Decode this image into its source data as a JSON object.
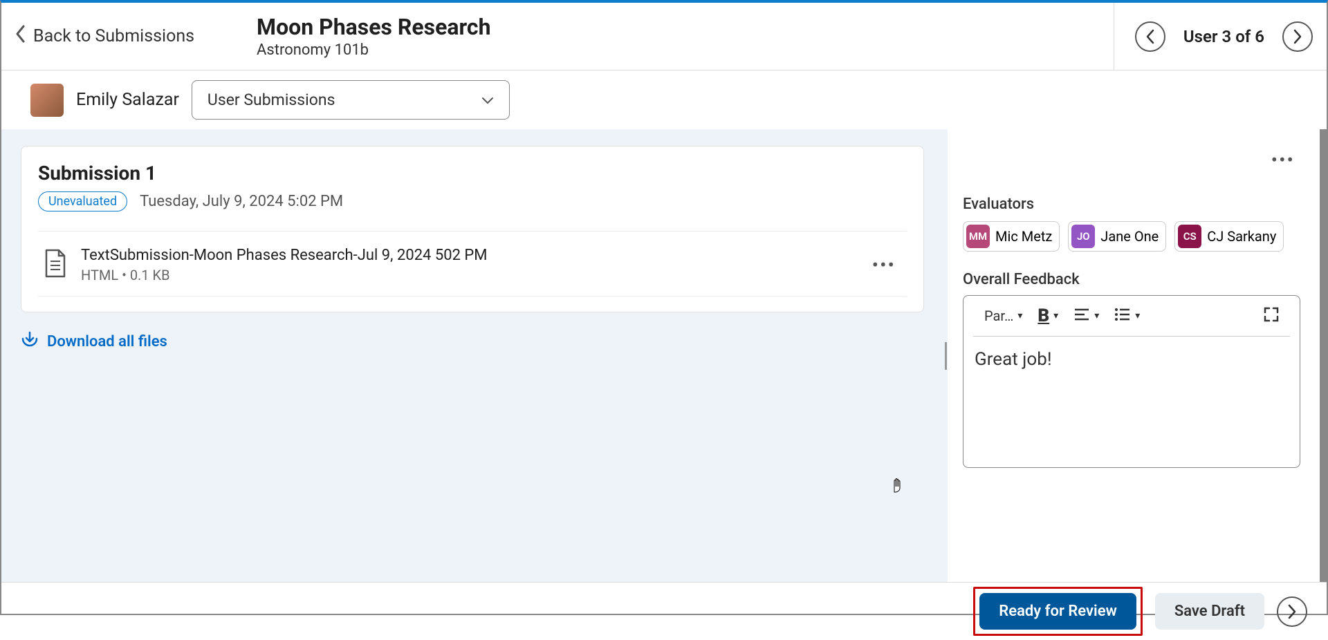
{
  "header": {
    "back_label": "Back to Submissions",
    "title": "Moon Phases Research",
    "subtitle": "Astronomy 101b",
    "user_nav_label": "User 3 of 6"
  },
  "subheader": {
    "user_name": "Emily Salazar",
    "dropdown_label": "User Submissions"
  },
  "submission": {
    "title": "Submission 1",
    "badge": "Unevaluated",
    "date": "Tuesday, July 9, 2024 5:02 PM",
    "file_name": "TextSubmission-Moon Phases Research-Jul 9, 2024 502 PM",
    "file_meta": "HTML  •  0.1 KB",
    "download_label": "Download all files"
  },
  "right": {
    "evaluators_label": "Evaluators",
    "evaluators": [
      {
        "initials": "MM",
        "name": "Mic Metz",
        "color": "#b54879"
      },
      {
        "initials": "JO",
        "name": "Jane One",
        "color": "#9455c4"
      },
      {
        "initials": "CS",
        "name": "CJ Sarkany",
        "color": "#8a1449"
      }
    ],
    "feedback_label": "Overall Feedback",
    "paragraph_label": "Par…",
    "feedback_content": "Great job!"
  },
  "footer": {
    "primary": "Ready for Review",
    "secondary": "Save Draft"
  }
}
